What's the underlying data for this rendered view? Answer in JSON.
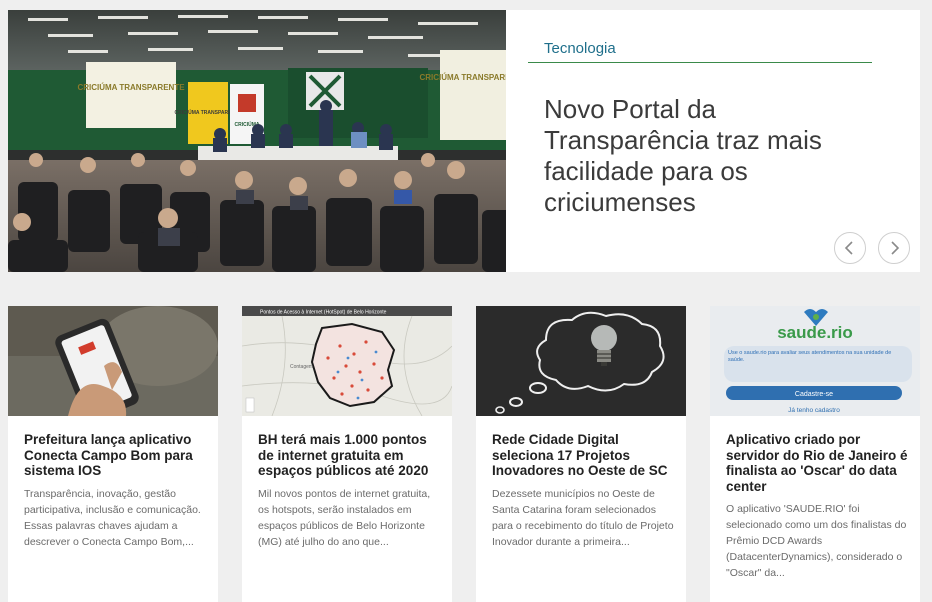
{
  "hero": {
    "category": "Tecnologia",
    "title": "Novo Portal da Transparência traz mais facilidade para os criciumenses",
    "photo": {
      "banner_left": "CRICIÚMA TRANSPARENTE",
      "banner_mid": "CRICIÚMA TRANSPARENTE",
      "banner_logo": "CRICIÚMA",
      "screen_right": "CRICIÚMA TRANSPARENTE"
    }
  },
  "cards": [
    {
      "title": "Prefeitura lança aplicativo Conecta Campo Bom para sistema IOS",
      "description": "Transparência, inovação, gestão participativa, inclusão e comunicação. Essas palavras chaves ajudam a descrever o Conecta Campo Bom,..."
    },
    {
      "title": "BH terá mais 1.000 pontos de internet gratuita em espaços públicos até 2020",
      "description": "Mil novos pontos de internet gratuita, os hotspots, serão instalados em espaços públicos de Belo Horizonte (MG) até julho do ano que...",
      "map_caption": "Pontos de Acesso à Internet (HotSpot) de Belo Horizonte",
      "map_place": "Contagem"
    },
    {
      "title": "Rede Cidade Digital seleciona 17 Projetos Inovadores no Oeste de SC",
      "description": "Dezessete municípios no Oeste de Santa Catarina foram selecionados para o recebimento do título de Projeto Inovador durante a primeira..."
    },
    {
      "title": "Aplicativo criado por servidor do Rio de Janeiro é finalista ao 'Oscar' do data center",
      "description": "O aplicativo 'SAUDE.RIO' foi selecionado como um dos finalistas do Prêmio DCD Awards (DatacenterDynamics), considerado o \"Oscar\" da...",
      "app_brand": "saude.rio",
      "app_text": "Use o saude.rio para avaliar seus atendimentos na sua unidade de saúde.",
      "app_button": "Cadastre-se",
      "app_link": "Já tenho cadastro"
    }
  ]
}
